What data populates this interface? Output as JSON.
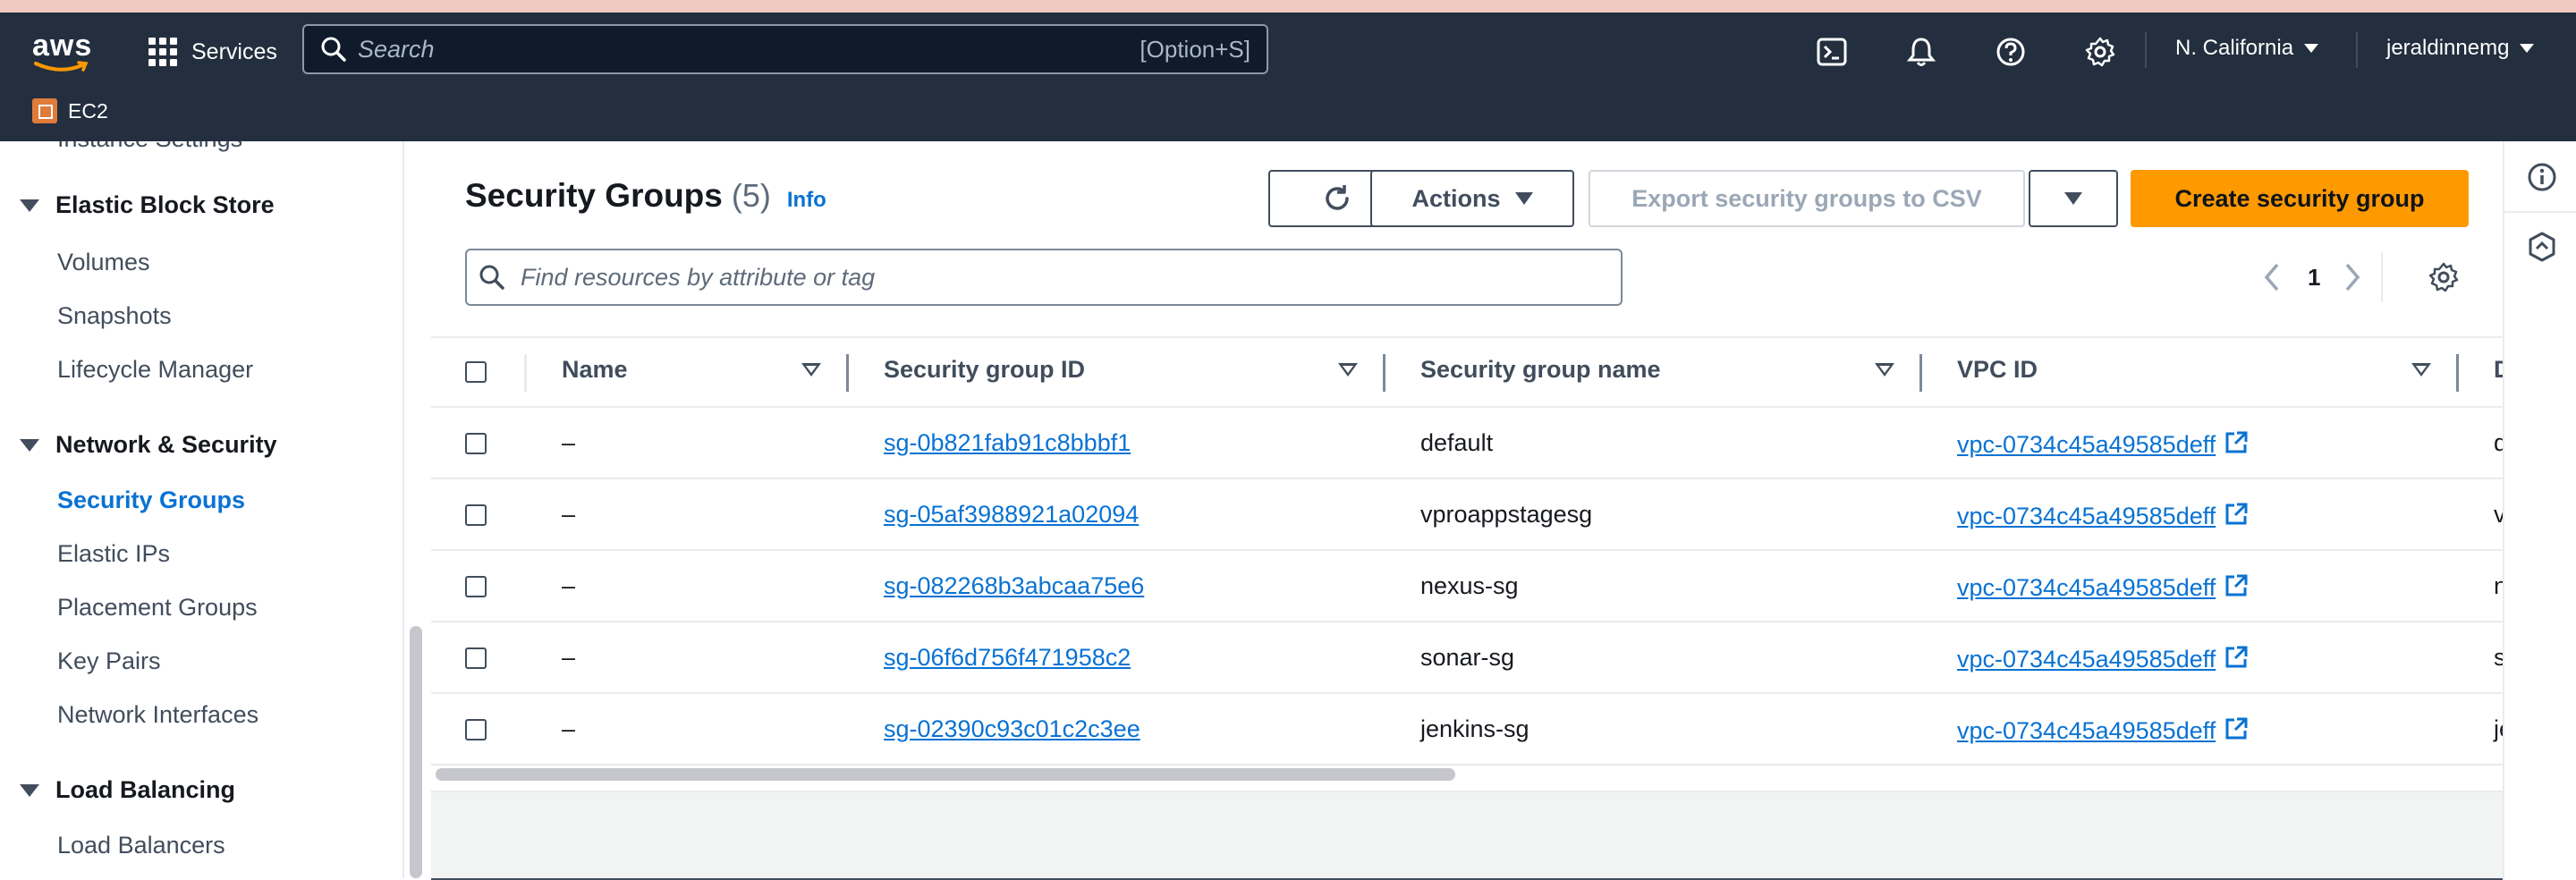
{
  "topnav": {
    "logo_text": "aws",
    "services_label": "Services",
    "search_placeholder": "Search",
    "search_shortcut": "[Option+S]",
    "region": "N. California",
    "user": "jeraldinnemg",
    "breadcrumb_service": "EC2"
  },
  "sidebar": {
    "cut_item": "Instance Settings",
    "sections": [
      {
        "title": "Elastic Block Store",
        "items": [
          "Volumes",
          "Snapshots",
          "Lifecycle Manager"
        ]
      },
      {
        "title": "Network & Security",
        "items": [
          "Security Groups",
          "Elastic IPs",
          "Placement Groups",
          "Key Pairs",
          "Network Interfaces"
        ]
      },
      {
        "title": "Load Balancing",
        "items": [
          "Load Balancers"
        ]
      }
    ],
    "active_item": "Security Groups"
  },
  "main": {
    "title": "Security Groups",
    "count": "(5)",
    "info": "Info",
    "actions_label": "Actions",
    "export_label": "Export security groups to CSV",
    "create_label": "Create security group",
    "filter_placeholder": "Find resources by attribute or tag",
    "page": "1"
  },
  "table": {
    "columns": [
      "Name",
      "Security group ID",
      "Security group name",
      "VPC ID",
      "D"
    ],
    "rows": [
      {
        "name": "–",
        "sg_id": "sg-0b821fab91c8bbbf1",
        "sg_name": "default",
        "vpc": "vpc-0734c45a49585deff",
        "desc": "d"
      },
      {
        "name": "–",
        "sg_id": "sg-05af3988921a02094",
        "sg_name": "vproappstagesg",
        "vpc": "vpc-0734c45a49585deff",
        "desc": "v"
      },
      {
        "name": "–",
        "sg_id": "sg-082268b3abcaa75e6",
        "sg_name": "nexus-sg",
        "vpc": "vpc-0734c45a49585deff",
        "desc": "n"
      },
      {
        "name": "–",
        "sg_id": "sg-06f6d756f471958c2",
        "sg_name": "sonar-sg",
        "vpc": "vpc-0734c45a49585deff",
        "desc": "s"
      },
      {
        "name": "–",
        "sg_id": "sg-02390c93c01c2c3ee",
        "sg_name": "jenkins-sg",
        "vpc": "vpc-0734c45a49585deff",
        "desc": "je"
      }
    ]
  },
  "colors": {
    "nav_bg": "#232f3e",
    "accent_orange": "#ff9900",
    "link_blue": "#0972d3"
  }
}
